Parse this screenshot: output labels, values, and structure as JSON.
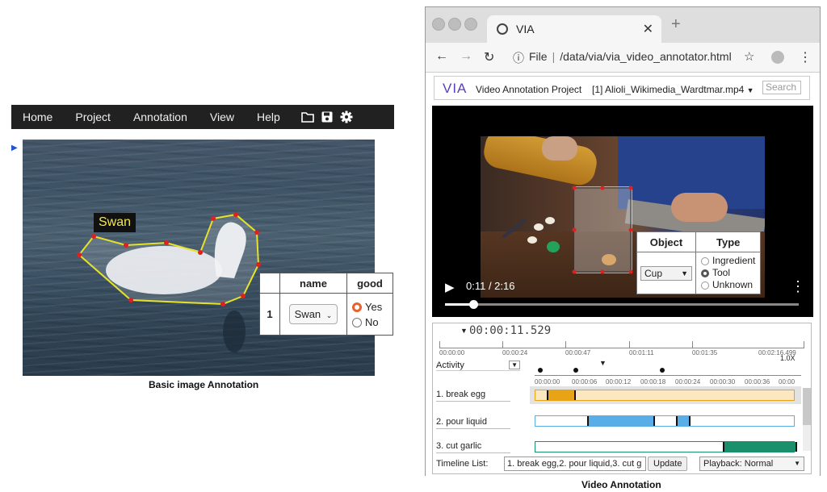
{
  "image_annotator": {
    "menu": [
      "Home",
      "Project",
      "Annotation",
      "View",
      "Help"
    ],
    "region_label": "Swan",
    "attributes": {
      "headers": [
        "name",
        "good"
      ],
      "row_index": "1",
      "name_value": "Swan",
      "good_options": [
        "Yes",
        "No"
      ],
      "good_selected": "Yes"
    },
    "caption": "Basic image Annotation"
  },
  "browser": {
    "tab_title": "VIA",
    "address_scheme": "File",
    "address_path": "/data/via/via_video_annotator.html"
  },
  "video_annotator": {
    "logo": "VIA",
    "project_name": "Video Annotation Project",
    "file_selector": "[1] Alioli_Wikimedia_Wardtmar.mp4",
    "search_placeholder": "Search",
    "object_table": {
      "headers": [
        "Object",
        "Type"
      ],
      "object_value": "Cup",
      "type_options": [
        "Ingredient",
        "Tool",
        "Unknown"
      ],
      "type_selected": "Tool"
    },
    "player": {
      "time_display": "0:11 / 2:16",
      "progress": 0.08
    },
    "timeline": {
      "current_time": "00:00:11.529",
      "ruler_top": [
        "00:00:00",
        "00:00:24",
        "00:00:47",
        "00:01:11",
        "00:01:35",
        "00:02:16.499"
      ],
      "ruler_bottom": [
        "00:00:00",
        "00:00:06",
        "00:00:12",
        "00:00:18",
        "00:00:24",
        "00:00:30",
        "00:00:36",
        "00:00"
      ],
      "zoom": "1.0X",
      "group_selector": "Activity",
      "rows": [
        {
          "label": "1. break egg",
          "color": "#e8a317",
          "bg": "#fbe7c0"
        },
        {
          "label": "2. pour liquid",
          "color": "#5aaee8",
          "bg": "#ffffff"
        },
        {
          "label": "3. cut garlic",
          "color": "#1a8f6b",
          "bg": "#ffffff"
        }
      ],
      "timeline_list_label": "Timeline List:",
      "timeline_list_value": "1. break egg,2. pour liquid,3. cut g",
      "update_button": "Update",
      "playback_mode": "Playback: Normal"
    },
    "caption": "Video Annotation"
  }
}
